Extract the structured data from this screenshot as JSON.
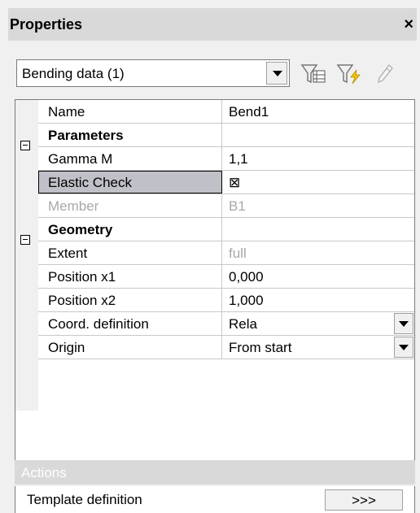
{
  "panel": {
    "title": "Properties",
    "close_glyph": "×"
  },
  "selector": {
    "value": "Bending data (1)"
  },
  "toolbar": {
    "icons": [
      "filter-table-icon",
      "filter-lightning-icon",
      "pencil-icon"
    ]
  },
  "grid": {
    "rows": [
      {
        "label": "Name",
        "value": "Bend1"
      },
      {
        "label": "Parameters",
        "value": "",
        "category": true
      },
      {
        "label": "Gamma M",
        "value": "1,1"
      },
      {
        "label": "Elastic Check",
        "value": "⊠",
        "selected": true
      },
      {
        "label": "Member",
        "value": "B1",
        "readonly": true
      },
      {
        "label": "Geometry",
        "value": "",
        "category": true
      },
      {
        "label": "Extent",
        "value": "full",
        "readonly": true
      },
      {
        "label": "Position x1",
        "value": "0,000"
      },
      {
        "label": "Position x2",
        "value": "1,000"
      },
      {
        "label": "Coord. definition",
        "value": "Rela",
        "dropdown": true
      },
      {
        "label": "Origin",
        "value": "From start",
        "dropdown": true
      }
    ]
  },
  "actions": {
    "header": "Actions",
    "item_label": "Template definition",
    "item_button": ">>>"
  }
}
